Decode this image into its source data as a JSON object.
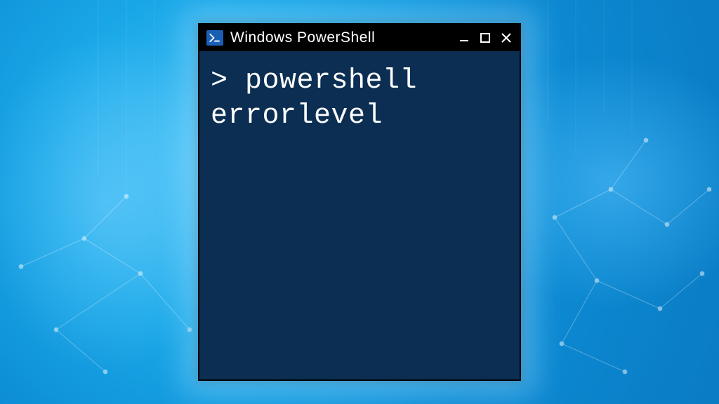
{
  "window": {
    "title": "Windows PowerShell",
    "icon": "powershell-icon"
  },
  "terminal": {
    "prompt": ">",
    "command_line1": "> powershell",
    "command_line2": "errorlevel"
  },
  "colors": {
    "terminal_bg": "#0b2e52",
    "titlebar_bg": "#000000",
    "text": "#ffffff",
    "icon_bg": "#1a5fb4"
  }
}
